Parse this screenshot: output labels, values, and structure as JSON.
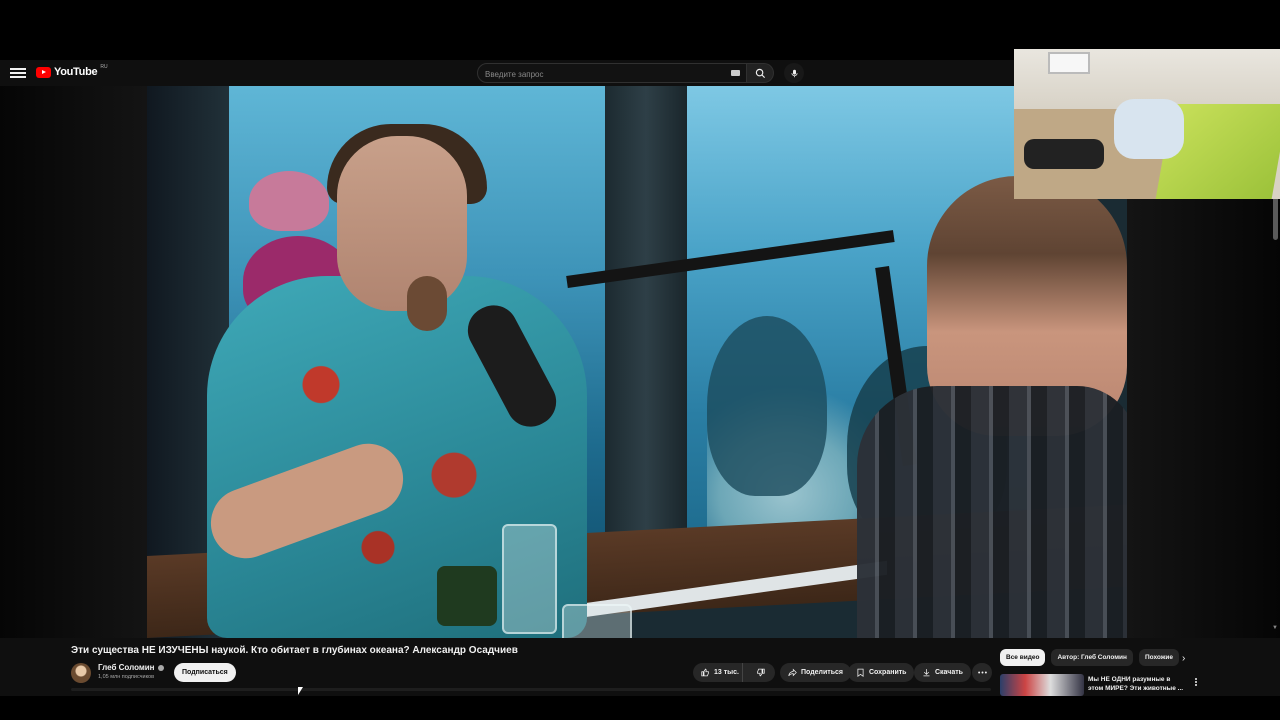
{
  "masthead": {
    "logo_text": "YouTube",
    "logo_country": "RU",
    "search_placeholder": "Введите запрос",
    "icons": [
      "menu-icon",
      "youtube-logo",
      "keyboard-icon",
      "search-icon",
      "mic-icon"
    ]
  },
  "video": {
    "title": "Эти существа НЕ ИЗУЧЕНЫ наукой. Кто обитает в глубинах океана? Александр Осадчиев"
  },
  "channel": {
    "name": "Глеб Соломин",
    "subscribers": "1,05 млн подписчиков",
    "subscribe_label": "Подписаться"
  },
  "actions": {
    "likes": "13 тыс.",
    "share_label": "Поделиться",
    "save_label": "Сохранить",
    "download_label": "Скачать"
  },
  "chips": [
    {
      "label": "Все видео",
      "active": true
    },
    {
      "label": "Автор: Глеб Соломин",
      "active": false
    },
    {
      "label": "Похожие",
      "active": false
    }
  ],
  "recommendation": {
    "title_line1": "Мы НЕ ОДНИ разумные в",
    "title_line2": "этом МИРЕ? Эти животные ..."
  }
}
